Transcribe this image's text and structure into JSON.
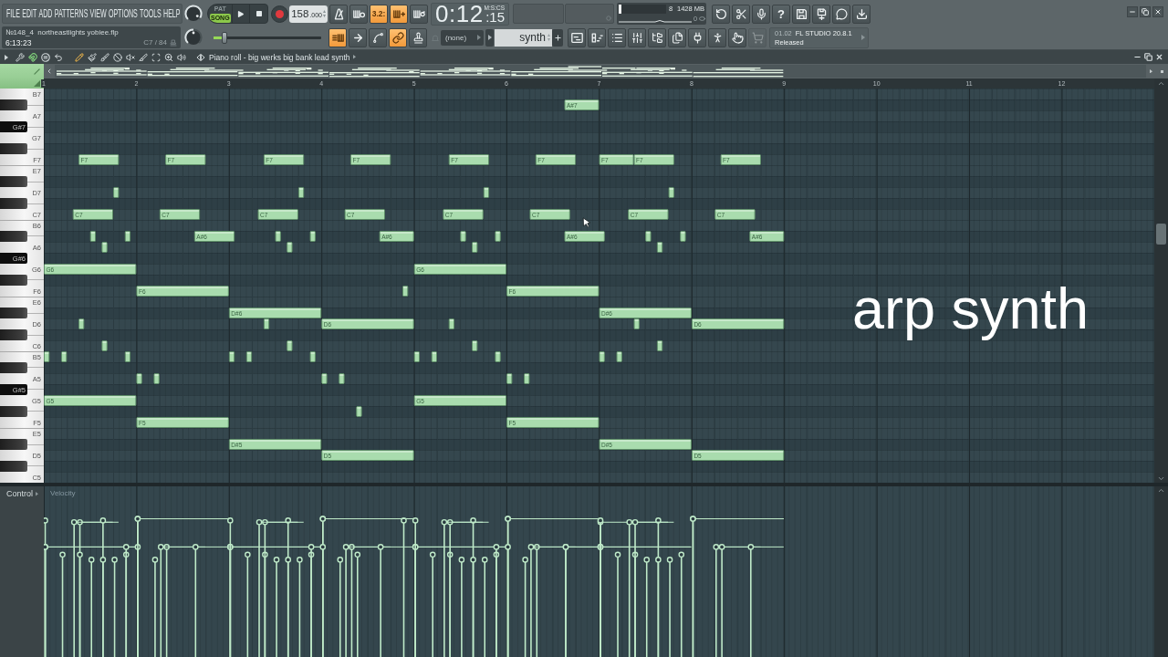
{
  "menu": [
    "FILE",
    "EDIT",
    "ADD",
    "PATTERNS",
    "VIEW",
    "OPTIONS",
    "TOOLS",
    "HELP"
  ],
  "song": {
    "title": "№148_4  northeastlights yobiee.flp",
    "time": "6:13:23",
    "note": "C7 / 84"
  },
  "knobs": [
    {
      "level": 0.95
    },
    {
      "level": 0.5
    }
  ],
  "transport": {
    "modes": [
      {
        "label": "PAT",
        "selected": false
      },
      {
        "label": "SONG",
        "selected": true
      }
    ],
    "tempo": "158",
    "tempo_decimals": ".000"
  },
  "pitch_slider": {
    "level": 0.1
  },
  "record_toggles": [
    {
      "kind": "metronome",
      "on": false
    },
    {
      "kind": "wait",
      "on": false
    },
    {
      "kind": "countdown",
      "label": "3.2:",
      "on": true
    },
    {
      "kind": "blend",
      "on": true
    },
    {
      "kind": "loop",
      "on": false
    }
  ],
  "edit_toggles": [
    {
      "kind": "step",
      "on": true
    },
    {
      "kind": "typing",
      "on": false
    },
    {
      "kind": "curve",
      "on": false
    },
    {
      "kind": "link",
      "on": true
    },
    {
      "kind": "stamp",
      "on": false
    }
  ],
  "time": {
    "main": "0:12",
    "small": ":15",
    "unit": "M:S:CS"
  },
  "monitor": {
    "level": 0.05,
    "polyphony": "8",
    "memory": "1428 MB",
    "cpu": "0"
  },
  "help_button": "?",
  "pattern": {
    "channel": "(none)",
    "name": "synth"
  },
  "view_buttons": [
    {
      "kind": "playlist",
      "disabled": false
    },
    {
      "kind": "pianoroll",
      "disabled": false
    },
    {
      "kind": "channels",
      "disabled": false
    },
    {
      "kind": "mixer",
      "disabled": false
    },
    {
      "kind": "browser",
      "disabled": false
    },
    {
      "kind": "documents",
      "disabled": false
    },
    {
      "kind": "plugins",
      "disabled": false
    },
    {
      "kind": "person",
      "disabled": false
    },
    {
      "kind": "pointer",
      "disabled": false
    },
    {
      "kind": "shop",
      "disabled": true
    }
  ],
  "news": {
    "date": "01.02",
    "title": "FL STUDIO 20.8.1",
    "status": "Released"
  },
  "piano_roll": {
    "title": "Piano roll - big werks big bank lead synth",
    "keys": [
      {
        "kind": "white"
      },
      {
        "kind": "black"
      },
      {
        "kind": "white"
      },
      {
        "kind": "black",
        "label": "G#7"
      },
      {
        "kind": "white"
      },
      {
        "kind": "black"
      },
      {
        "kind": "white"
      },
      {
        "kind": "white"
      },
      {
        "kind": "black"
      },
      {
        "kind": "white"
      },
      {
        "kind": "black"
      },
      {
        "kind": "white"
      },
      {
        "kind": "white"
      },
      {
        "kind": "black"
      },
      {
        "kind": "white"
      },
      {
        "kind": "black",
        "label": "G#6"
      },
      {
        "kind": "white"
      },
      {
        "kind": "black"
      },
      {
        "kind": "white"
      },
      {
        "kind": "white"
      },
      {
        "kind": "black"
      },
      {
        "kind": "white"
      },
      {
        "kind": "black"
      },
      {
        "kind": "white"
      },
      {
        "kind": "white"
      },
      {
        "kind": "black"
      },
      {
        "kind": "white"
      },
      {
        "kind": "black",
        "label": "G#5"
      },
      {
        "kind": "white"
      },
      {
        "kind": "black"
      },
      {
        "kind": "white"
      },
      {
        "kind": "white"
      },
      {
        "kind": "black"
      },
      {
        "kind": "white"
      },
      {
        "kind": "black"
      },
      {
        "kind": "white"
      }
    ],
    "chart_data": [
      {
        "type": "bar",
        "orientation": "horizontal",
        "color": "#a9dcae",
        "xticks": [
          1,
          2,
          3,
          4,
          5,
          6,
          7,
          8,
          9,
          10,
          11,
          12
        ],
        "xlim": [
          1,
          13
        ],
        "categories": [
          "B7",
          null,
          "A7",
          null,
          "G7",
          null,
          "F7",
          "E7",
          null,
          "D7",
          null,
          "C7",
          "B6",
          null,
          "A6",
          null,
          "G6",
          null,
          "F6",
          "E6",
          null,
          "D6",
          null,
          "C6",
          "B5",
          null,
          "A5",
          null,
          "G5",
          null,
          "F5",
          "E5",
          null,
          "D5",
          null,
          "C5"
        ],
        "annotations": [
          "A#7",
          "F7",
          "F7",
          "F7",
          "F7",
          "F7",
          "F7",
          "F7",
          "F7",
          "F7",
          "C7",
          "C7",
          "C7",
          "C7",
          "C7",
          "C7",
          "C7",
          "C7",
          "A#6",
          "A#6",
          "A#6",
          "A#6",
          "G6",
          "G6",
          "F6",
          "F6",
          "D#6",
          "D#6",
          "D6",
          "D6",
          "G5",
          "G5",
          "F5",
          "F5",
          "D#5",
          "D#5",
          "D5",
          "D5"
        ],
        "series": [
          {
            "base": [
              null,
              6.625,
              null,
              null,
              null,
              null,
              1.375,
              null,
              null,
              1.75,
              null,
              1.3125,
              null,
              1.5,
              1.625,
              null,
              1,
              null,
              2,
              null,
              3,
              1.375,
              null,
              1.625,
              1,
              null,
              2,
              null,
              1,
              4.375,
              2,
              null,
              3,
              4,
              null,
              null
            ],
            "values": [
              null,
              0.375,
              null,
              null,
              null,
              null,
              0.4375,
              null,
              null,
              0.0625,
              null,
              0.4375,
              null,
              0.0625,
              0.0625,
              null,
              1,
              null,
              1,
              null,
              1,
              0.0625,
              null,
              0.0625,
              0.0625,
              null,
              0.0625,
              null,
              1,
              0.0625,
              1,
              null,
              1,
              1,
              null,
              null
            ]
          },
          {
            "base": [
              null,
              null,
              null,
              null,
              null,
              null,
              2.3125,
              null,
              null,
              3.75,
              null,
              2.25,
              null,
              1.875,
              3.625,
              null,
              5,
              null,
              4.875,
              null,
              7,
              3.375,
              null,
              3.625,
              1.1875,
              null,
              2.1875,
              null,
              5,
              null,
              6,
              null,
              7,
              8,
              null,
              null
            ],
            "values": [
              null,
              null,
              null,
              null,
              null,
              null,
              0.4375,
              null,
              null,
              0.0625,
              null,
              0.4375,
              null,
              0.0625,
              0.0625,
              null,
              1,
              null,
              0.0625,
              null,
              1,
              0.0625,
              null,
              0.0625,
              0.0625,
              null,
              0.0625,
              null,
              1,
              null,
              1,
              null,
              1,
              1,
              null,
              null
            ]
          },
          {
            "base": [
              null,
              null,
              null,
              null,
              null,
              null,
              3.375,
              null,
              null,
              5.75,
              null,
              3.3125,
              null,
              2.625,
              5.625,
              null,
              null,
              null,
              6,
              null,
              null,
              4,
              null,
              5.625,
              1.875,
              null,
              4,
              null,
              null,
              null,
              null,
              null,
              null,
              null,
              null,
              null
            ],
            "values": [
              null,
              null,
              null,
              null,
              null,
              null,
              0.4375,
              null,
              null,
              0.0625,
              null,
              0.4375,
              null,
              0.4375,
              0.0625,
              null,
              null,
              null,
              1,
              null,
              null,
              1,
              null,
              0.0625,
              0.0625,
              null,
              0.0625,
              null,
              null,
              null,
              null,
              null,
              null,
              null,
              null,
              null
            ]
          },
          {
            "base": [
              null,
              null,
              null,
              null,
              null,
              null,
              4.3125,
              null,
              null,
              7.75,
              null,
              4.25,
              null,
              3.5,
              7.625,
              null,
              null,
              null,
              null,
              null,
              null,
              5.375,
              null,
              7.625,
              3,
              null,
              4.1875,
              null,
              null,
              null,
              null,
              null,
              null,
              null,
              null,
              null
            ],
            "values": [
              null,
              null,
              null,
              null,
              null,
              null,
              0.4375,
              null,
              null,
              0.0625,
              null,
              0.4375,
              null,
              0.0625,
              0.0625,
              null,
              null,
              null,
              null,
              null,
              null,
              0.0625,
              null,
              0.0625,
              0.0625,
              null,
              0.0625,
              null,
              null,
              null,
              null,
              null,
              null,
              null,
              null,
              null
            ]
          },
          {
            "base": [
              null,
              null,
              null,
              null,
              null,
              null,
              5.375,
              null,
              null,
              null,
              null,
              5.3125,
              null,
              3.875,
              null,
              null,
              null,
              null,
              null,
              null,
              null,
              7.375,
              null,
              null,
              3.1875,
              null,
              6,
              null,
              null,
              null,
              null,
              null,
              null,
              null,
              null,
              null
            ],
            "values": [
              null,
              null,
              null,
              null,
              null,
              null,
              0.4375,
              null,
              null,
              null,
              null,
              0.4375,
              null,
              0.0625,
              null,
              null,
              null,
              null,
              null,
              null,
              null,
              0.0625,
              null,
              null,
              0.0625,
              null,
              0.0625,
              null,
              null,
              null,
              null,
              null,
              null,
              null,
              null,
              null
            ]
          },
          {
            "base": [
              null,
              null,
              null,
              null,
              null,
              null,
              6.3125,
              null,
              null,
              null,
              null,
              6.25,
              null,
              4.625,
              null,
              null,
              null,
              null,
              null,
              null,
              null,
              8,
              null,
              null,
              3.875,
              null,
              6.1875,
              null,
              null,
              null,
              null,
              null,
              null,
              null,
              null,
              null
            ],
            "values": [
              null,
              null,
              null,
              null,
              null,
              null,
              0.4375,
              null,
              null,
              null,
              null,
              0.4375,
              null,
              0.375,
              null,
              null,
              null,
              null,
              null,
              null,
              null,
              1,
              null,
              null,
              0.0625,
              null,
              0.0625,
              null,
              null,
              null,
              null,
              null,
              null,
              null,
              null,
              null
            ]
          },
          {
            "base": [
              null,
              null,
              null,
              null,
              null,
              null,
              7,
              null,
              null,
              null,
              null,
              7.3125,
              null,
              5.5,
              null,
              null,
              null,
              null,
              null,
              null,
              null,
              null,
              null,
              null,
              5,
              null,
              null,
              null,
              null,
              null,
              null,
              null,
              null,
              null,
              null,
              null
            ],
            "values": [
              null,
              null,
              null,
              null,
              null,
              null,
              0.375,
              null,
              null,
              null,
              null,
              0.4375,
              null,
              0.0625,
              null,
              null,
              null,
              null,
              null,
              null,
              null,
              null,
              null,
              null,
              0.0625,
              null,
              null,
              null,
              null,
              null,
              null,
              null,
              null,
              null,
              null,
              null
            ]
          },
          {
            "base": [
              null,
              null,
              null,
              null,
              null,
              null,
              7.375,
              null,
              null,
              null,
              null,
              8.25,
              null,
              5.875,
              null,
              null,
              null,
              null,
              null,
              null,
              null,
              null,
              null,
              null,
              5.1875,
              null,
              null,
              null,
              null,
              null,
              null,
              null,
              null,
              null,
              null,
              null
            ],
            "values": [
              null,
              null,
              null,
              null,
              null,
              null,
              0.4375,
              null,
              null,
              null,
              null,
              0.4375,
              null,
              0.0625,
              null,
              null,
              null,
              null,
              null,
              null,
              null,
              null,
              null,
              null,
              0.0625,
              null,
              null,
              null,
              null,
              null,
              null,
              null,
              null,
              null,
              null,
              null
            ]
          },
          {
            "base": [
              null,
              null,
              null,
              null,
              null,
              null,
              8.3125,
              null,
              null,
              null,
              null,
              null,
              null,
              6.625,
              null,
              null,
              null,
              null,
              null,
              null,
              null,
              null,
              null,
              null,
              5.875,
              null,
              null,
              null,
              null,
              null,
              null,
              null,
              null,
              null,
              null,
              null
            ],
            "values": [
              null,
              null,
              null,
              null,
              null,
              null,
              0.4375,
              null,
              null,
              null,
              null,
              null,
              null,
              0.4375,
              null,
              null,
              null,
              null,
              null,
              null,
              null,
              null,
              null,
              null,
              0.0625,
              null,
              null,
              null,
              null,
              null,
              null,
              null,
              null,
              null,
              null,
              null
            ]
          },
          {
            "base": [
              null,
              null,
              null,
              null,
              null,
              null,
              null,
              null,
              null,
              null,
              null,
              null,
              null,
              7.5,
              null,
              null,
              null,
              null,
              null,
              null,
              null,
              null,
              null,
              null,
              7,
              null,
              null,
              null,
              null,
              null,
              null,
              null,
              null,
              null,
              null,
              null
            ],
            "values": [
              null,
              null,
              null,
              null,
              null,
              null,
              null,
              null,
              null,
              null,
              null,
              null,
              null,
              0.0625,
              null,
              null,
              null,
              null,
              null,
              null,
              null,
              null,
              null,
              null,
              0.0625,
              null,
              null,
              null,
              null,
              null,
              null,
              null,
              null,
              null,
              null,
              null
            ]
          },
          {
            "base": [
              null,
              null,
              null,
              null,
              null,
              null,
              null,
              null,
              null,
              null,
              null,
              null,
              null,
              7.875,
              null,
              null,
              null,
              null,
              null,
              null,
              null,
              null,
              null,
              null,
              7.1875,
              null,
              null,
              null,
              null,
              null,
              null,
              null,
              null,
              null,
              null,
              null
            ],
            "values": [
              null,
              null,
              null,
              null,
              null,
              null,
              null,
              null,
              null,
              null,
              null,
              null,
              null,
              0.0625,
              null,
              null,
              null,
              null,
              null,
              null,
              null,
              null,
              null,
              null,
              0.0625,
              null,
              null,
              null,
              null,
              null,
              null,
              null,
              null,
              null,
              null,
              null
            ]
          },
          {
            "base": [
              null,
              null,
              null,
              null,
              null,
              null,
              null,
              null,
              null,
              null,
              null,
              null,
              null,
              8.625,
              null,
              null,
              null,
              null,
              null,
              null,
              null,
              null,
              null,
              null,
              null,
              null,
              null,
              null,
              null,
              null,
              null,
              null,
              null,
              null,
              null,
              null
            ],
            "values": [
              null,
              null,
              null,
              null,
              null,
              null,
              null,
              null,
              null,
              null,
              null,
              null,
              null,
              0.375,
              null,
              null,
              null,
              null,
              null,
              null,
              null,
              null,
              null,
              null,
              null,
              null,
              null,
              null,
              null,
              null,
              null,
              null,
              null,
              null,
              null,
              null
            ]
          }
        ]
      }
    ],
    "caption": "arp synth"
  },
  "control": {
    "label": "Control",
    "lane": "Velocity"
  }
}
